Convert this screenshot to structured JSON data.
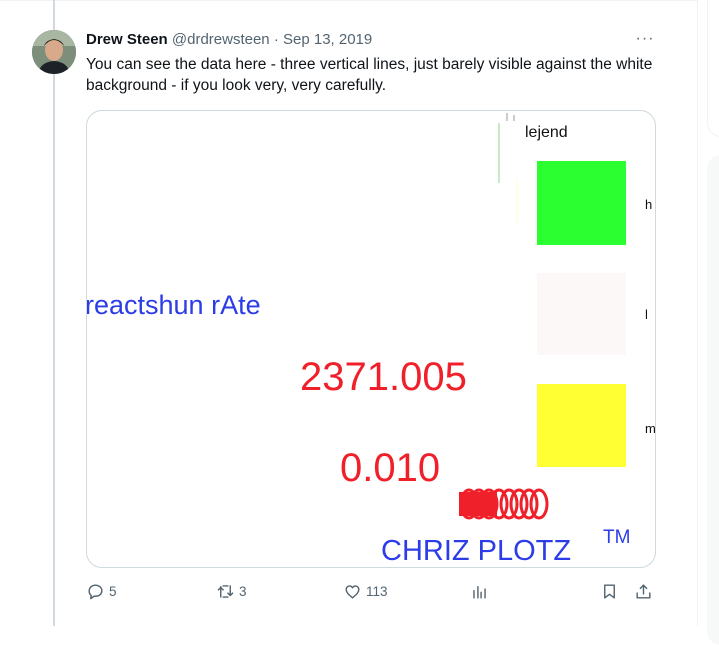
{
  "tweet": {
    "display_name": "Drew Steen",
    "handle": "@drdrewsteen",
    "separator": "·",
    "date": "Sep 13, 2019",
    "more_label": "···",
    "text": "You can see the data here - three vertical lines, just barely visible against the white background - if you look very, very carefully."
  },
  "media": {
    "legend_title": "lejend",
    "legend_items": [
      {
        "label": "h",
        "color": "#2cff2f"
      },
      {
        "label": "l",
        "color": "#fdf8f8"
      },
      {
        "label": "m",
        "color": "#ffff33"
      }
    ],
    "ylabel": "reactshun rAte",
    "tick_top": "2371.005",
    "tick_bottom": "0.010",
    "credit": "CHRIZ PLOTZ",
    "credit_mark": "TM",
    "colors": {
      "ylabel": "#2b3ce8",
      "ticks": "#f0202a",
      "credit": "#2b3ce8"
    }
  },
  "actions": {
    "reply_count": "5",
    "retweet_count": "3",
    "like_count": "113"
  }
}
